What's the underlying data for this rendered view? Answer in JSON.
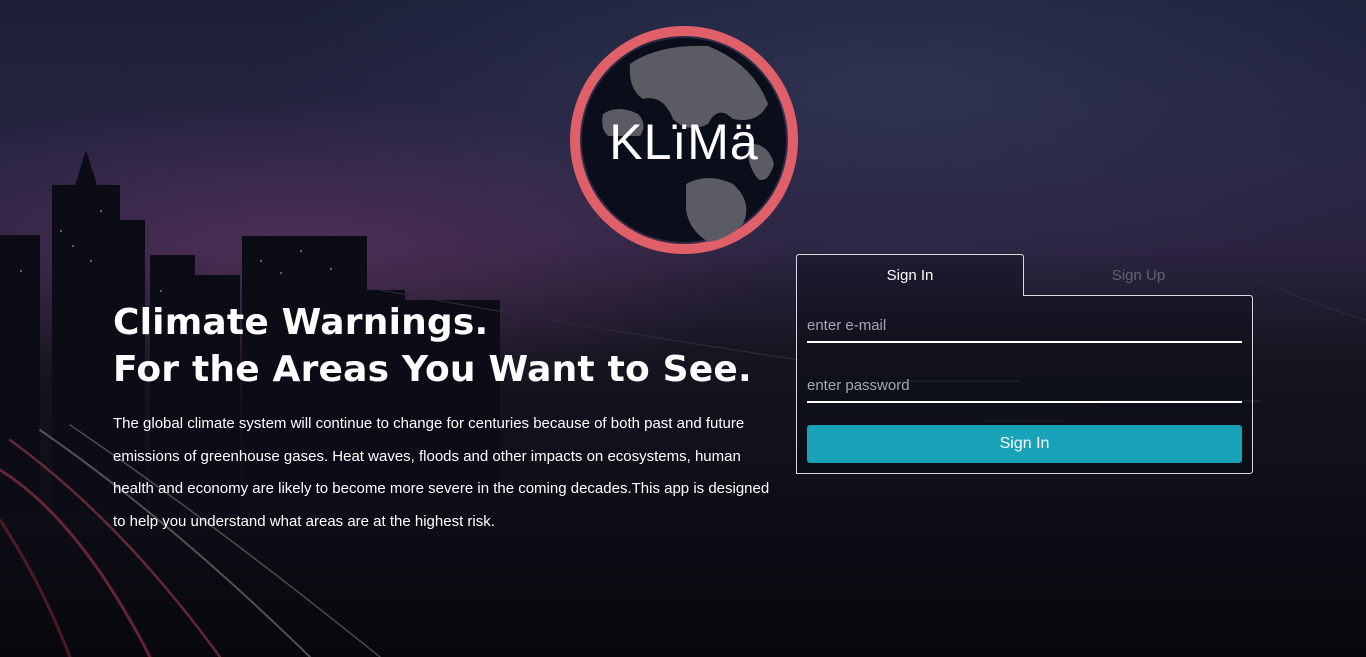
{
  "brand": {
    "logo_text": "KLïMä"
  },
  "hero": {
    "title_line1": "Climate Warnings.",
    "title_line2": "For the Areas You Want to See.",
    "description": "The global climate system will continue to change for centuries because of both past and future emissions of greenhouse gases. Heat waves, floods and other impacts on ecosystems, human health and economy are likely to become more severe in the coming decades.This app is designed to help you understand what areas are at the highest risk."
  },
  "auth": {
    "tabs": [
      {
        "label": "Sign In",
        "active": true
      },
      {
        "label": "Sign Up",
        "active": false
      }
    ],
    "email": {
      "placeholder": "enter e-mail",
      "value": ""
    },
    "password": {
      "placeholder": "enter password",
      "value": ""
    },
    "submit_label": "Sign In"
  },
  "colors": {
    "accent_button": "#17a2b8",
    "logo_ring": "#e0606a",
    "inactive_tab": "#5f6370"
  }
}
